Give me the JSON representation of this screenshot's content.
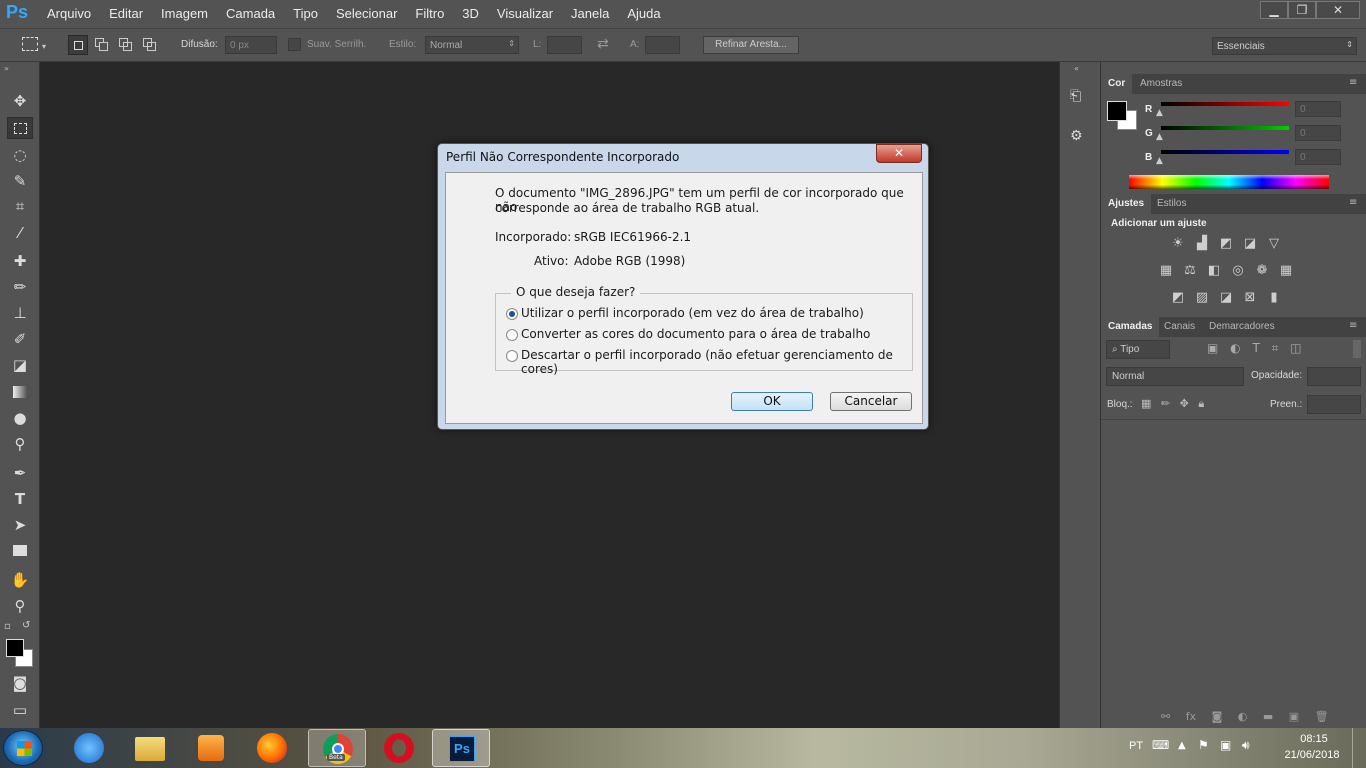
{
  "app": {
    "logo": "Ps"
  },
  "menu": [
    "Arquivo",
    "Editar",
    "Imagem",
    "Camada",
    "Tipo",
    "Selecionar",
    "Filtro",
    "3D",
    "Visualizar",
    "Janela",
    "Ajuda"
  ],
  "window_controls": {
    "minimize": "▁",
    "restore": "❐",
    "close": "✕"
  },
  "options": {
    "feather_label": "Difusão:",
    "feather_value": "0 px",
    "antialias_label": "Suav. Serrilh.",
    "style_label": "Estilo:",
    "style_value": "Normal",
    "width_label": "L:",
    "height_label": "A:",
    "refine_label": "Refinar Aresta...",
    "workspace": "Essenciais"
  },
  "color_panel": {
    "tabs": [
      "Cor",
      "Amostras"
    ],
    "channels": [
      {
        "label": "R",
        "value": "0",
        "color": "#ff0000"
      },
      {
        "label": "G",
        "value": "0",
        "color": "#00cc00"
      },
      {
        "label": "B",
        "value": "0",
        "color": "#0000ff"
      }
    ]
  },
  "adjust_panel": {
    "tabs": [
      "Ajustes",
      "Estilos"
    ],
    "heading": "Adicionar um ajuste",
    "icons": [
      [
        "brightness-icon",
        "levels-icon",
        "curves-icon",
        "exposure-icon",
        "vibrance-icon"
      ],
      [
        "hue-saturation-icon",
        "color-balance-icon",
        "black-white-icon",
        "photo-filter-icon",
        "channel-mixer-icon",
        "color-lookup-icon"
      ],
      [
        "invert-icon",
        "posterize-icon",
        "threshold-icon",
        "selective-color-icon",
        "gradient-map-icon"
      ]
    ]
  },
  "layers_panel": {
    "tabs": [
      "Camadas",
      "Canais",
      "Demarcadores"
    ],
    "filter_label": "Tipo",
    "blend_mode": "Normal",
    "opacity_label": "Opacidade:",
    "lock_label": "Bloq.:",
    "fill_label": "Preen.:"
  },
  "dialog": {
    "title": "Perfil Não Correspondente Incorporado",
    "close": "✕",
    "message_line1": "O documento \"IMG_2896.JPG\" tem um perfil de cor incorporado que não",
    "message_line2": "corresponde ao área de trabalho RGB atual.",
    "embedded_label": "Incorporado:",
    "embedded_value": "sRGB IEC61966-2.1",
    "working_label": "Ativo:",
    "working_value": "Adobe RGB (1998)",
    "group_label": "O que deseja fazer?",
    "options": [
      "Utilizar o perfil incorporado (em vez do área de trabalho)",
      "Converter as cores do documento para o área de trabalho",
      "Descartar o perfil incorporado (não efetuar gerenciamento de cores)"
    ],
    "selected_option": 0,
    "ok_label": "OK",
    "cancel_label": "Cancelar"
  },
  "taskbar": {
    "apps": [
      "Internet Explorer",
      "Windows Explorer",
      "Windows Media Player",
      "Firefox",
      "Chrome Beta",
      "Opera",
      "Photoshop"
    ],
    "language": "PT",
    "time": "08:15",
    "date": "21/06/2018",
    "chrome_badge": "Beta",
    "photoshop_label": "Ps"
  }
}
